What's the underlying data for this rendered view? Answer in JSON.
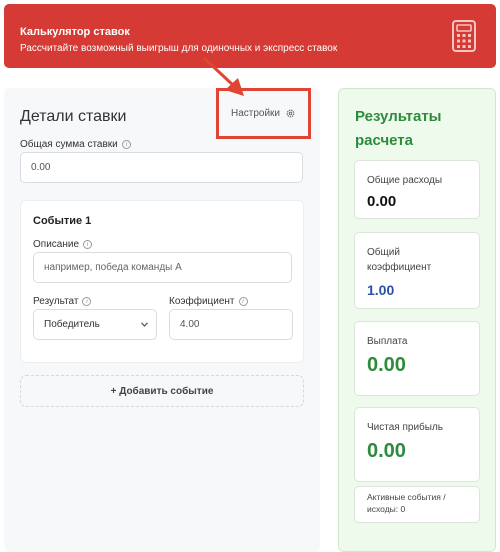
{
  "header": {
    "title": "Калькулятор ставок",
    "subtitle": "Рассчитайте возможный выигрыш для одиночных и экспресс ставок",
    "icon": "calculator-icon"
  },
  "bet_details": {
    "title": "Детали ставки",
    "settings_label": "Настройки",
    "total_stake_label": "Общая сумма ставки",
    "total_stake_value": "0.00"
  },
  "event": {
    "title": "Событие 1",
    "description_label": "Описание",
    "description_placeholder": "например, победа команды А",
    "result_label": "Результат",
    "result_selected": "Победитель",
    "odds_label": "Коэффициент",
    "odds_value": "4.00"
  },
  "add_event_label": "+ Добавить событие",
  "results": {
    "title": "Результаты расчета",
    "total_cost_label": "Общие расходы",
    "total_cost_value": "0.00",
    "total_odds_label": "Общий коэффициент",
    "total_odds_value": "1.00",
    "payout_label": "Выплата",
    "payout_value": "0.00",
    "net_profit_label": "Чистая прибыль",
    "net_profit_value": "0.00",
    "active_events_label": "Активные события / исходы: 0"
  },
  "colors": {
    "header_bg": "#d63a34",
    "results_green": "#2e8b3e",
    "odds_blue": "#2b4fa8",
    "annotation_red": "#e04433"
  }
}
